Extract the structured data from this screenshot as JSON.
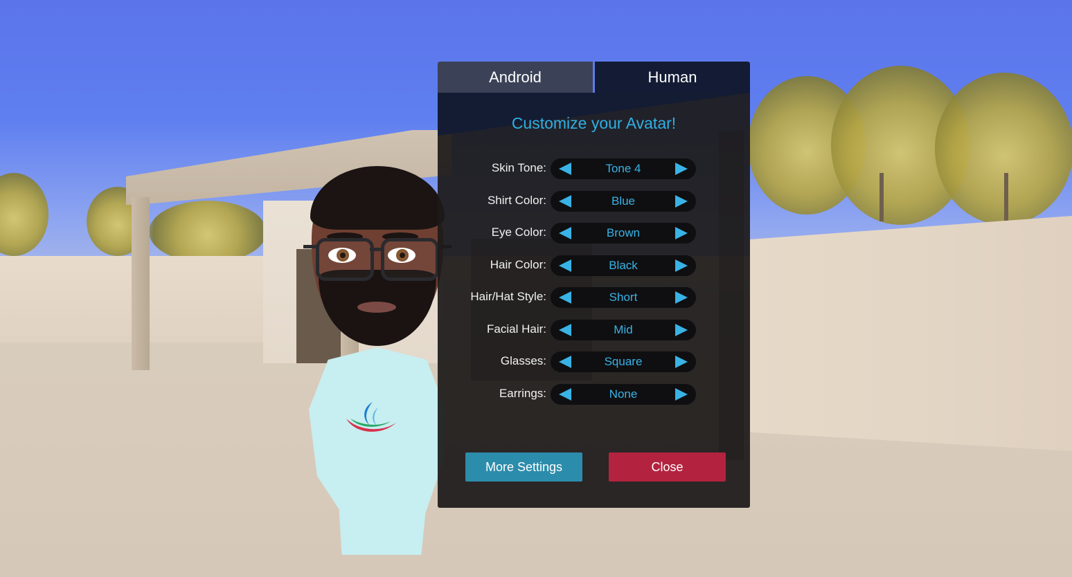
{
  "tabs": [
    {
      "label": "Android",
      "active": false
    },
    {
      "label": "Human",
      "active": true
    }
  ],
  "panel": {
    "title": "Customize your Avatar!"
  },
  "options": [
    {
      "label": "Skin Tone:",
      "value": "Tone 4"
    },
    {
      "label": "Shirt Color:",
      "value": "Blue"
    },
    {
      "label": "Eye Color:",
      "value": "Brown"
    },
    {
      "label": "Hair Color:",
      "value": "Black"
    },
    {
      "label": "Hair/Hat Style:",
      "value": "Short"
    },
    {
      "label": "Facial Hair:",
      "value": "Mid"
    },
    {
      "label": "Glasses:",
      "value": "Square"
    },
    {
      "label": "Earrings:",
      "value": "None"
    }
  ],
  "buttons": {
    "more_settings": "More Settings",
    "close": "Close"
  },
  "colors": {
    "accent": "#39b3e6",
    "more_settings_bg": "#2c8cab",
    "close_bg": "#b3233f",
    "active_tab_bg": "#131c34",
    "inactive_tab_bg": "#3b4257"
  }
}
